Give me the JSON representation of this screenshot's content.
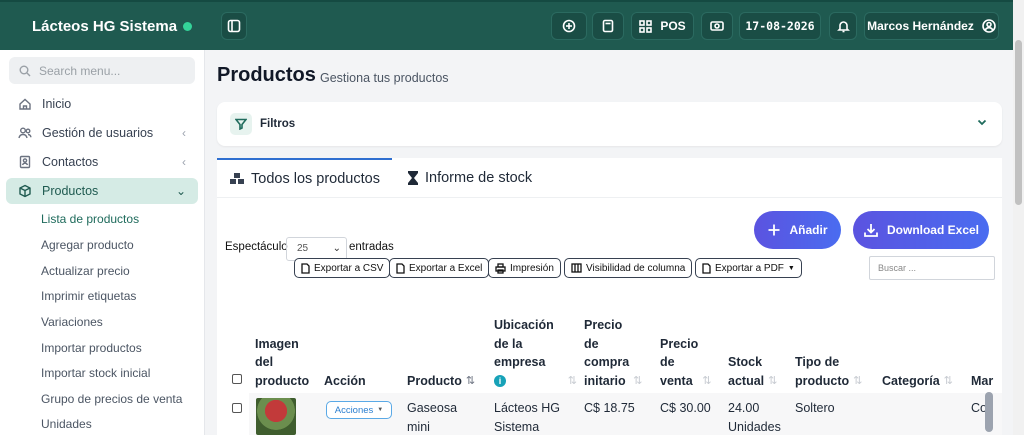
{
  "header": {
    "brand": "Lácteos HG Sistema",
    "pos_label": "POS",
    "date": "17-08-2026",
    "user_name": "Marcos Hernández"
  },
  "sidebar": {
    "search_placeholder": "Search menu...",
    "items": [
      {
        "label": "Inicio",
        "icon": "home-icon"
      },
      {
        "label": "Gestión de usuarios",
        "icon": "users-icon"
      },
      {
        "label": "Contactos",
        "icon": "contacts-icon"
      },
      {
        "label": "Productos",
        "icon": "box-icon"
      }
    ],
    "sub_items": [
      "Lista de productos",
      "Agregar producto",
      "Actualizar precio",
      "Imprimir etiquetas",
      "Variaciones",
      "Importar productos",
      "Importar stock inicial",
      "Grupo de precios de venta",
      "Unidades"
    ]
  },
  "main": {
    "title": "Productos",
    "subtitle": "Gestiona tus productos",
    "filters_label": "Filtros",
    "tabs": [
      "Todos los productos",
      "Informe de stock"
    ],
    "add_button": "Añadir",
    "download_button": "Download Excel",
    "show_label": "Espectáculo",
    "entries_value": "25",
    "entries_label": "entradas",
    "export_buttons": [
      "Exportar a CSV",
      "Exportar a Excel",
      "Impresión",
      "Visibilidad de columna",
      "Exportar a PDF"
    ],
    "search_placeholder": "Buscar ...",
    "table": {
      "headers": [
        "Imagen del producto",
        "Acción",
        "Producto",
        "Ubicación de la empresa",
        "Precio de compra initario",
        "Precio de venta",
        "Stock actual",
        "Tipo de producto",
        "Categoría",
        "Mar"
      ],
      "header_lines": {
        "imagen": [
          "Imagen",
          "del",
          "producto"
        ],
        "ubicacion": [
          "Ubicación",
          "de la",
          "empresa"
        ],
        "compra": [
          "Precio",
          "de",
          "compra",
          "initario"
        ],
        "venta": [
          "Precio",
          "de",
          "venta"
        ],
        "stock": [
          "Stock",
          "actual"
        ],
        "tipo": [
          "Tipo de",
          "producto"
        ]
      },
      "row": {
        "action": "Acciones",
        "product": [
          "Gaseosa",
          "mini"
        ],
        "location": [
          "Lácteos HG",
          "Sistema"
        ],
        "purchase_price": "C$ 18.75",
        "sale_price": "C$ 30.00",
        "stock": [
          "24.00",
          "Unidades"
        ],
        "type": "Soltero",
        "category": "",
        "brand_partial": "Co"
      }
    }
  },
  "colors": {
    "header_bg": "#1f5a50",
    "accent": "#5b53e0",
    "active_nav": "#d5ebe5"
  }
}
